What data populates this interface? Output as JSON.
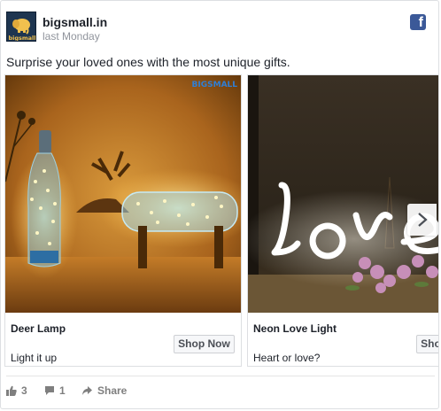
{
  "post": {
    "page_name": "bigsmall.in",
    "timestamp": "last Monday",
    "message": "Surprise your loved ones with the most unique gifts.",
    "avatar_text": "bigsmall",
    "brand_watermark": "BIGSMALL"
  },
  "carousel": {
    "cards": [
      {
        "title": "Deer Lamp",
        "description": "Light it up",
        "cta": "Shop Now"
      },
      {
        "title": "Neon Love Light",
        "description": "Heart or love?",
        "cta": "Shop Now"
      }
    ]
  },
  "footer": {
    "likes": "3",
    "comments": "1",
    "share_label": "Share"
  },
  "icons": {
    "network": "facebook-icon",
    "like": "thumbs-up-icon",
    "comment": "comment-icon",
    "share": "share-arrow-icon",
    "next": "chevron-right-icon"
  },
  "colors": {
    "facebook_blue": "#3b5998",
    "meta_text": "#90949c",
    "footer_text": "#7f7f7f"
  }
}
